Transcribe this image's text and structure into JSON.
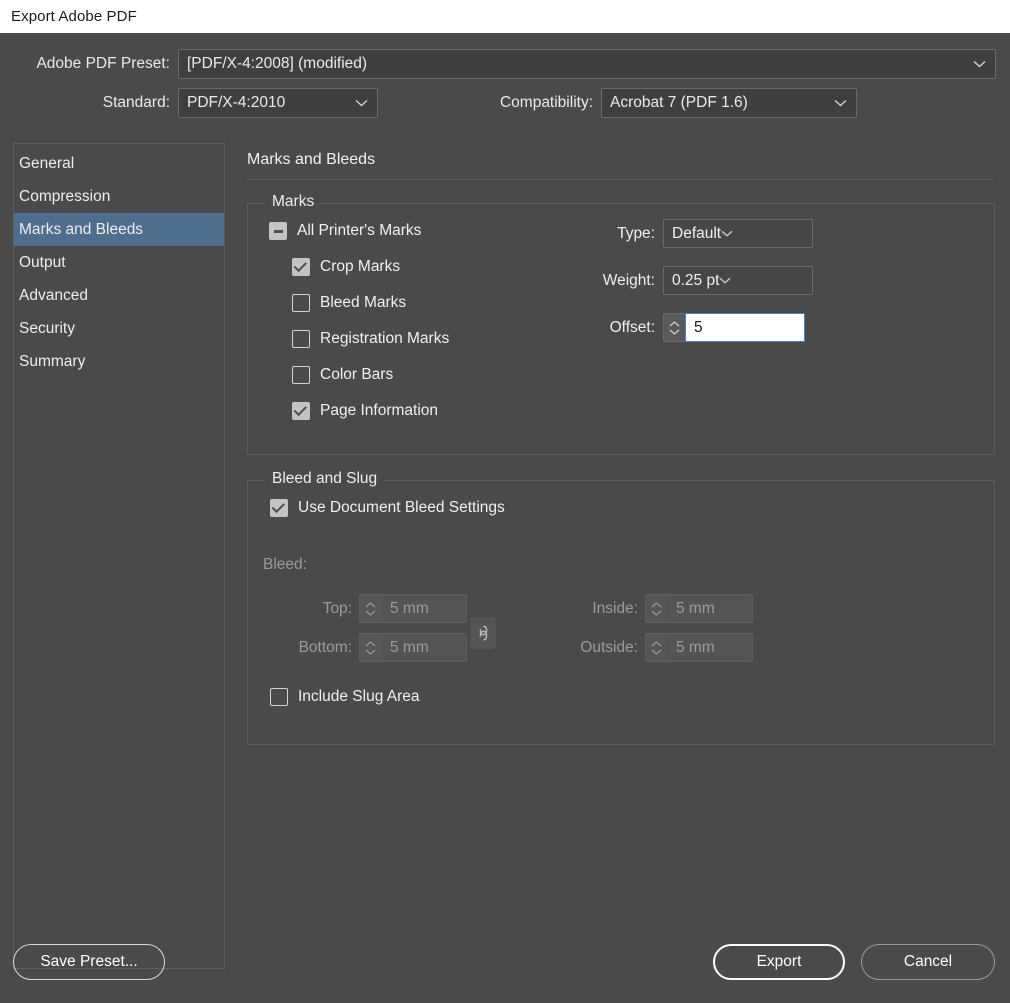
{
  "window": {
    "title": "Export Adobe PDF"
  },
  "header": {
    "preset_label": "Adobe PDF Preset:",
    "preset_value": "[PDF/X-4:2008] (modified)",
    "standard_label": "Standard:",
    "standard_value": "PDF/X-4:2010",
    "compatibility_label": "Compatibility:",
    "compatibility_value": "Acrobat 7 (PDF 1.6)"
  },
  "sidebar": {
    "items": [
      {
        "label": "General",
        "selected": false
      },
      {
        "label": "Compression",
        "selected": false
      },
      {
        "label": "Marks and Bleeds",
        "selected": true
      },
      {
        "label": "Output",
        "selected": false
      },
      {
        "label": "Advanced",
        "selected": false
      },
      {
        "label": "Security",
        "selected": false
      },
      {
        "label": "Summary",
        "selected": false
      }
    ]
  },
  "panel": {
    "title": "Marks and Bleeds",
    "marks_group": {
      "legend": "Marks",
      "checkboxes": [
        {
          "label": "All Printer's Marks",
          "state": "indeterminate"
        },
        {
          "label": "Crop Marks",
          "state": "checked"
        },
        {
          "label": "Bleed Marks",
          "state": "unchecked"
        },
        {
          "label": "Registration Marks",
          "state": "unchecked"
        },
        {
          "label": "Color Bars",
          "state": "unchecked"
        },
        {
          "label": "Page Information",
          "state": "checked"
        }
      ],
      "type_label": "Type:",
      "type_value": "Default",
      "weight_label": "Weight:",
      "weight_value": "0.25 pt",
      "offset_label": "Offset:",
      "offset_value": "5"
    },
    "bleed_group": {
      "legend": "Bleed and Slug",
      "use_document_bleed_label": "Use Document Bleed Settings",
      "use_document_bleed_state": "checked",
      "bleed_caption": "Bleed:",
      "top_label": "Top:",
      "top_value": "5 mm",
      "bottom_label": "Bottom:",
      "bottom_value": "5 mm",
      "inside_label": "Inside:",
      "inside_value": "5 mm",
      "outside_label": "Outside:",
      "outside_value": "5 mm",
      "link_icon": "chain-link-icon",
      "include_slug_label": "Include Slug Area",
      "include_slug_state": "unchecked"
    }
  },
  "buttons": {
    "save_preset": "Save Preset...",
    "export": "Export",
    "cancel": "Cancel"
  },
  "colors": {
    "dialog_background": "#4a4a4a",
    "titlebar_background": "#ffffff",
    "selection_highlight": "#4d6e8d",
    "input_focus_border": "#4a7fc1",
    "active_input_background": "#ffffff"
  }
}
